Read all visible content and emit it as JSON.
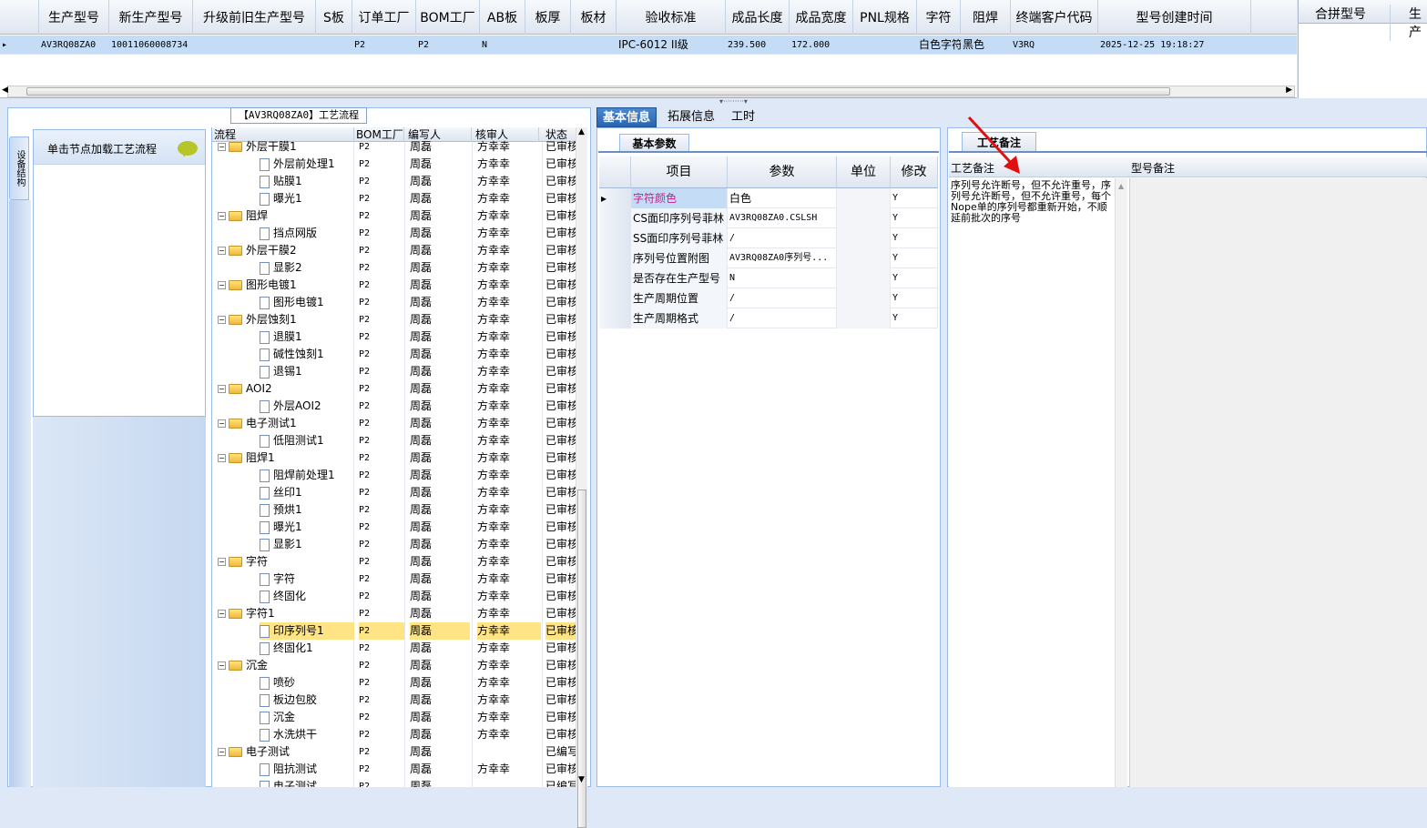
{
  "top_grid": {
    "headers": [
      "生产型号",
      "新生产型号",
      "升级前旧生产型号",
      "S板",
      "订单工厂",
      "BOM工厂",
      "AB板",
      "板厚",
      "板材",
      "验收标准",
      "成品长度",
      "成品宽度",
      "PNL规格",
      "字符",
      "阻焊",
      "终端客户代码",
      "型号创建时间"
    ],
    "row": [
      "AV3RQ08ZA0",
      "10011060008734",
      "",
      "",
      "P2",
      "P2",
      "N",
      "",
      "",
      "IPC-6012 II级",
      "239.500",
      "172.000",
      "",
      "白色字符",
      "黑色",
      "V3RQ",
      "2025-12-25 19:18:27"
    ]
  },
  "merge_panel": {
    "headers": [
      "合拼型号",
      "生产"
    ]
  },
  "left": {
    "title_tab": "【AV3RQ08ZA0】工艺流程",
    "vertical_tab": "设备结构",
    "node_hint": "单击节点加载工艺流程"
  },
  "tree": {
    "headers": [
      "流程",
      "BOM工厂",
      "编写人",
      "核审人",
      "状态"
    ],
    "rows": [
      {
        "name": "外层干膜1",
        "level": 0,
        "bom": "P2",
        "writer": "周磊",
        "reviewer": "方幸幸",
        "status": "已审核"
      },
      {
        "name": "外层前处理1",
        "level": 1,
        "bom": "P2",
        "writer": "周磊",
        "reviewer": "方幸幸",
        "status": "已审核"
      },
      {
        "name": "贴膜1",
        "level": 1,
        "bom": "P2",
        "writer": "周磊",
        "reviewer": "方幸幸",
        "status": "已审核"
      },
      {
        "name": "曝光1",
        "level": 1,
        "bom": "P2",
        "writer": "周磊",
        "reviewer": "方幸幸",
        "status": "已审核"
      },
      {
        "name": "阻焊",
        "level": 0,
        "bom": "P2",
        "writer": "周磊",
        "reviewer": "方幸幸",
        "status": "已审核"
      },
      {
        "name": "挡点网版",
        "level": 1,
        "bom": "P2",
        "writer": "周磊",
        "reviewer": "方幸幸",
        "status": "已审核"
      },
      {
        "name": "外层干膜2",
        "level": 0,
        "bom": "P2",
        "writer": "周磊",
        "reviewer": "方幸幸",
        "status": "已审核"
      },
      {
        "name": "显影2",
        "level": 1,
        "bom": "P2",
        "writer": "周磊",
        "reviewer": "方幸幸",
        "status": "已审核"
      },
      {
        "name": "图形电镀1",
        "level": 0,
        "bom": "P2",
        "writer": "周磊",
        "reviewer": "方幸幸",
        "status": "已审核"
      },
      {
        "name": "图形电镀1",
        "level": 1,
        "bom": "P2",
        "writer": "周磊",
        "reviewer": "方幸幸",
        "status": "已审核"
      },
      {
        "name": "外层蚀刻1",
        "level": 0,
        "bom": "P2",
        "writer": "周磊",
        "reviewer": "方幸幸",
        "status": "已审核"
      },
      {
        "name": "退膜1",
        "level": 1,
        "bom": "P2",
        "writer": "周磊",
        "reviewer": "方幸幸",
        "status": "已审核"
      },
      {
        "name": "碱性蚀刻1",
        "level": 1,
        "bom": "P2",
        "writer": "周磊",
        "reviewer": "方幸幸",
        "status": "已审核"
      },
      {
        "name": "退锡1",
        "level": 1,
        "bom": "P2",
        "writer": "周磊",
        "reviewer": "方幸幸",
        "status": "已审核"
      },
      {
        "name": "AOI2",
        "level": 0,
        "bom": "P2",
        "writer": "周磊",
        "reviewer": "方幸幸",
        "status": "已审核"
      },
      {
        "name": "外层AOI2",
        "level": 1,
        "bom": "P2",
        "writer": "周磊",
        "reviewer": "方幸幸",
        "status": "已审核"
      },
      {
        "name": "电子测试1",
        "level": 0,
        "bom": "P2",
        "writer": "周磊",
        "reviewer": "方幸幸",
        "status": "已审核"
      },
      {
        "name": "低阻测试1",
        "level": 1,
        "bom": "P2",
        "writer": "周磊",
        "reviewer": "方幸幸",
        "status": "已审核"
      },
      {
        "name": "阻焊1",
        "level": 0,
        "bom": "P2",
        "writer": "周磊",
        "reviewer": "方幸幸",
        "status": "已审核"
      },
      {
        "name": "阻焊前处理1",
        "level": 1,
        "bom": "P2",
        "writer": "周磊",
        "reviewer": "方幸幸",
        "status": "已审核"
      },
      {
        "name": "丝印1",
        "level": 1,
        "bom": "P2",
        "writer": "周磊",
        "reviewer": "方幸幸",
        "status": "已审核"
      },
      {
        "name": "预烘1",
        "level": 1,
        "bom": "P2",
        "writer": "周磊",
        "reviewer": "方幸幸",
        "status": "已审核"
      },
      {
        "name": "曝光1",
        "level": 1,
        "bom": "P2",
        "writer": "周磊",
        "reviewer": "方幸幸",
        "status": "已审核"
      },
      {
        "name": "显影1",
        "level": 1,
        "bom": "P2",
        "writer": "周磊",
        "reviewer": "方幸幸",
        "status": "已审核"
      },
      {
        "name": "字符",
        "level": 0,
        "bom": "P2",
        "writer": "周磊",
        "reviewer": "方幸幸",
        "status": "已审核"
      },
      {
        "name": "字符",
        "level": 1,
        "bom": "P2",
        "writer": "周磊",
        "reviewer": "方幸幸",
        "status": "已审核"
      },
      {
        "name": "终固化",
        "level": 1,
        "bom": "P2",
        "writer": "周磊",
        "reviewer": "方幸幸",
        "status": "已审核"
      },
      {
        "name": "字符1",
        "level": 0,
        "bom": "P2",
        "writer": "周磊",
        "reviewer": "方幸幸",
        "status": "已审核"
      },
      {
        "name": "印序列号1",
        "level": 1,
        "bom": "P2",
        "writer": "周磊",
        "reviewer": "方幸幸",
        "status": "已审核",
        "selected": true
      },
      {
        "name": "终固化1",
        "level": 1,
        "bom": "P2",
        "writer": "周磊",
        "reviewer": "方幸幸",
        "status": "已审核"
      },
      {
        "name": "沉金",
        "level": 0,
        "bom": "P2",
        "writer": "周磊",
        "reviewer": "方幸幸",
        "status": "已审核"
      },
      {
        "name": "喷砂",
        "level": 1,
        "bom": "P2",
        "writer": "周磊",
        "reviewer": "方幸幸",
        "status": "已审核"
      },
      {
        "name": "板边包胶",
        "level": 1,
        "bom": "P2",
        "writer": "周磊",
        "reviewer": "方幸幸",
        "status": "已审核"
      },
      {
        "name": "沉金",
        "level": 1,
        "bom": "P2",
        "writer": "周磊",
        "reviewer": "方幸幸",
        "status": "已审核"
      },
      {
        "name": "水洗烘干",
        "level": 1,
        "bom": "P2",
        "writer": "周磊",
        "reviewer": "方幸幸",
        "status": "已审核"
      },
      {
        "name": "电子测试",
        "level": 0,
        "bom": "P2",
        "writer": "周磊",
        "reviewer": "",
        "status": "已编写"
      },
      {
        "name": "阻抗测试",
        "level": 1,
        "bom": "P2",
        "writer": "周磊",
        "reviewer": "方幸幸",
        "status": "已审核"
      },
      {
        "name": "电子测试",
        "level": 1,
        "bom": "P2",
        "writer": "周磊",
        "reviewer": "",
        "status": "已编写"
      }
    ]
  },
  "mid": {
    "tabs": [
      "基本信息",
      "拓展信息",
      "工时"
    ],
    "subtab": "基本参数",
    "headers": [
      "项目",
      "参数",
      "单位",
      "修改"
    ],
    "rows": [
      {
        "item": "字符颜色",
        "value": "白色",
        "unit": "",
        "edit": "Y",
        "highlight": true
      },
      {
        "item": "CS面印序列号菲林",
        "value": "AV3RQ08ZA0.CSLSH",
        "unit": "",
        "edit": "Y"
      },
      {
        "item": "SS面印序列号菲林",
        "value": "/",
        "unit": "",
        "edit": "Y"
      },
      {
        "item": "序列号位置附图",
        "value": "AV3RQ08ZA0序列号...",
        "unit": "",
        "edit": "Y"
      },
      {
        "item": "是否存在生产型号",
        "value": "N",
        "unit": "",
        "edit": "Y"
      },
      {
        "item": "生产周期位置",
        "value": "/",
        "unit": "",
        "edit": "Y"
      },
      {
        "item": "生产周期格式",
        "value": "/",
        "unit": "",
        "edit": "Y"
      }
    ]
  },
  "right": {
    "subtab": "工艺备注",
    "col1": "工艺备注",
    "col2": "型号备注",
    "memo": "序列号允许断号，但不允许重号，序列号允许断号，但不允许重号，每个Nope单的序列号都重新开始，不顺延前批次的序号"
  },
  "colors": {
    "selected_row": "#c4dcf6",
    "tree_selected": "#ffe486",
    "accent": "#2a66b0",
    "highlight_text": "#d01a8c",
    "arrow": "#e01010"
  }
}
